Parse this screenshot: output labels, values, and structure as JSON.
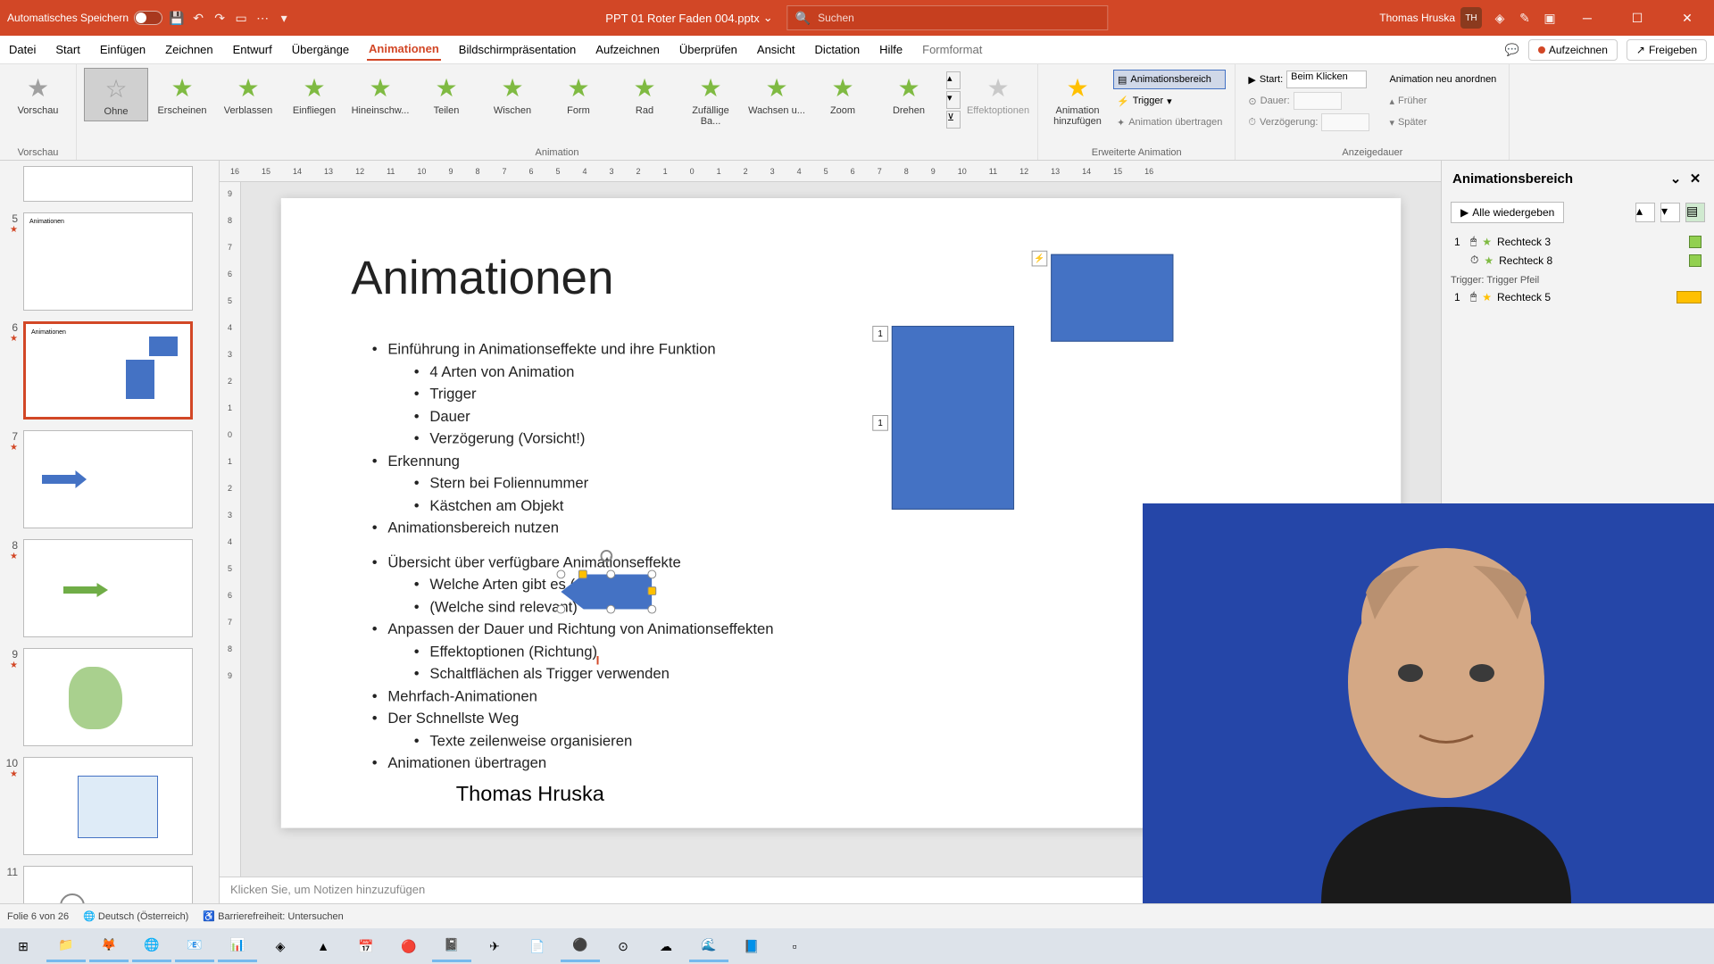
{
  "autosave_label": "Automatisches Speichern",
  "filename": "PPT 01 Roter Faden 004.pptx",
  "search_placeholder": "Suchen",
  "user_name": "Thomas Hruska",
  "user_initials": "TH",
  "menu": {
    "datei": "Datei",
    "start": "Start",
    "einfuegen": "Einfügen",
    "zeichnen": "Zeichnen",
    "entwurf": "Entwurf",
    "uebergaenge": "Übergänge",
    "animationen": "Animationen",
    "bildschirm": "Bildschirmpräsentation",
    "aufzeichnen": "Aufzeichnen",
    "ueberpruefen": "Überprüfen",
    "ansicht": "Ansicht",
    "dictation": "Dictation",
    "hilfe": "Hilfe",
    "formformat": "Formformat"
  },
  "menu_right": {
    "aufzeichnen": "Aufzeichnen",
    "freigeben": "Freigeben"
  },
  "ribbon": {
    "vorschau": "Vorschau",
    "vorschau_grp": "Vorschau",
    "ohne": "Ohne",
    "erscheinen": "Erscheinen",
    "verblassen": "Verblassen",
    "einfliegen": "Einfliegen",
    "hineinschw": "Hineinschw...",
    "teilen": "Teilen",
    "wischen": "Wischen",
    "form": "Form",
    "rad": "Rad",
    "zufaellige": "Zufällige Ba...",
    "wachsen": "Wachsen u...",
    "zoom": "Zoom",
    "drehen": "Drehen",
    "animation_grp": "Animation",
    "effektoptionen": "Effektoptionen",
    "animation_hinzufuegen": "Animation hinzufügen",
    "animationsbereich": "Animationsbereich",
    "trigger": "Trigger",
    "uebertragen": "Animation übertragen",
    "erw_grp": "Erweiterte Animation",
    "start": "Start:",
    "start_val": "Beim Klicken",
    "dauer": "Dauer:",
    "verzoegerung": "Verzögerung:",
    "neu_anordnen": "Animation neu anordnen",
    "frueher": "Früher",
    "spaeter": "Später",
    "anzeige_grp": "Anzeigedauer"
  },
  "slide": {
    "title": "Animationen",
    "b1": "Einführung in Animationseffekte und ihre Funktion",
    "b1a": "4 Arten von Animation",
    "b1b": "Trigger",
    "b1c": "Dauer",
    "b1d": "Verzögerung (Vorsicht!)",
    "b2": "Erkennung",
    "b2a": "Stern bei Foliennummer",
    "b2b": "Kästchen am Objekt",
    "b3": "Animationsbereich nutzen",
    "b4": "Übersicht über verfügbare Animationseffekte",
    "b4a": "Welche Arten gibt es (preview)",
    "b4b": "(Welche sind relevant)",
    "b5": "Anpassen der Dauer und Richtung von Animationseffekten",
    "b5a": "Effektoptionen (Richtung)",
    "b5b": "Schaltflächen als Trigger verwenden",
    "b6": "Mehrfach-Animationen",
    "b7": "Der Schnellste Weg",
    "b7a": "Texte zeilenweise organisieren",
    "b8": "Animationen übertragen",
    "author": "Thomas Hruska",
    "tag1": "1",
    "tag2": "1",
    "lightning": "⚡"
  },
  "pane": {
    "title": "Animationsbereich",
    "play": "Alle wiedergeben",
    "i1": "Rechteck 3",
    "i2": "Rechteck 8",
    "trigger": "Trigger: Trigger Pfeil",
    "i3": "Rechteck 5",
    "idx1": "1",
    "idx3": "1"
  },
  "notes": "Klicken Sie, um Notizen hinzuzufügen",
  "status": {
    "folie": "Folie 6 von 26",
    "lang": "Deutsch (Österreich)",
    "access": "Barrierefreiheit: Untersuchen"
  },
  "thumbs": {
    "n5": "5",
    "n6": "6",
    "n7": "7",
    "n8": "8",
    "n9": "9",
    "n10": "10",
    "n11": "11"
  },
  "ruler_h": [
    "16",
    "15",
    "14",
    "13",
    "12",
    "11",
    "10",
    "9",
    "8",
    "7",
    "6",
    "5",
    "4",
    "3",
    "2",
    "1",
    "0",
    "1",
    "2",
    "3",
    "4",
    "5",
    "6",
    "7",
    "8",
    "9",
    "10",
    "11",
    "12",
    "13",
    "14",
    "15",
    "16"
  ],
  "ruler_v": [
    "9",
    "8",
    "7",
    "6",
    "5",
    "4",
    "3",
    "2",
    "1",
    "0",
    "1",
    "2",
    "3",
    "4",
    "5",
    "6",
    "7",
    "8",
    "9"
  ]
}
